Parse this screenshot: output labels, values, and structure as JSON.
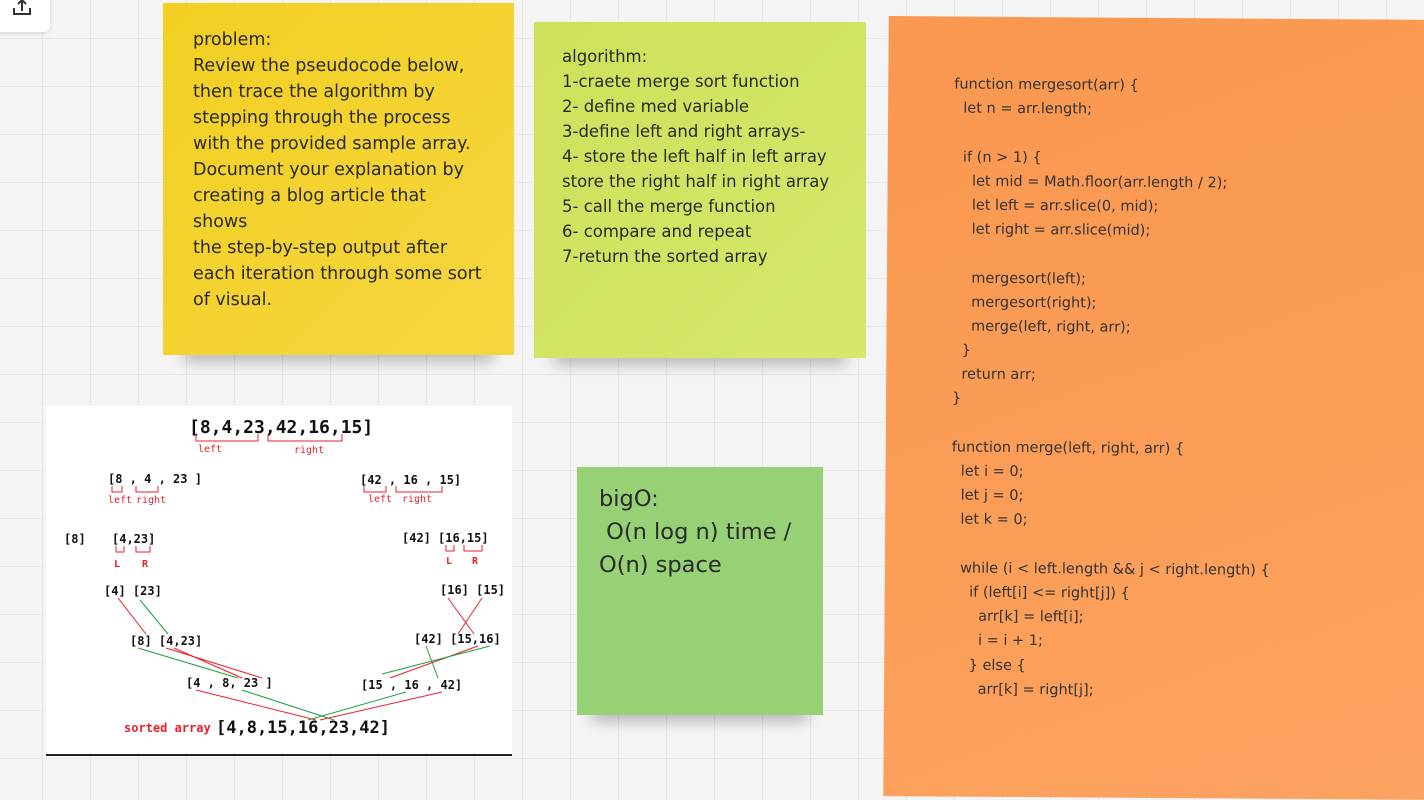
{
  "problem_note": {
    "lines": [
      "problem:",
      "Review the pseudocode below,",
      "then trace the algorithm by",
      "stepping through the process",
      "with the provided sample array.",
      "Document your explanation by",
      "creating a blog article that shows",
      "the step-by-step output after",
      "each iteration through some sort",
      "of visual."
    ]
  },
  "algorithm_note": {
    "lines": [
      "algorithm:",
      "1-craete merge sort function",
      "2- define med variable",
      "3-define left and right arrays-",
      "4- store the left half in left array",
      "store the right half in right array",
      "5- call the merge function",
      "6- compare and repeat",
      "7-return the sorted array"
    ]
  },
  "bigo_note": {
    "lines": [
      "bigO:",
      " O(n log n) time /",
      "O(n) space"
    ]
  },
  "code_note": {
    "lines": [
      "function mergesort(arr) {",
      "  let n = arr.length;",
      "",
      "  if (n > 1) {",
      "    let mid = Math.floor(arr.length / 2);",
      "    let left = arr.slice(0, mid);",
      "    let right = arr.slice(mid);",
      "",
      "    mergesort(left);",
      "    mergesort(right);",
      "    merge(left, right, arr);",
      "  }",
      "  return arr;",
      "}",
      "",
      "function merge(left, right, arr) {",
      "  let i = 0;",
      "  let j = 0;",
      "  let k = 0;",
      "",
      "  while (i < left.length && j < right.length) {",
      "    if (left[i] <= right[j]) {",
      "      arr[k] = left[i];",
      "      i = i + 1;",
      "    } else {",
      "      arr[k] = right[j];"
    ]
  },
  "diagram": {
    "root": "[8,4,23,42,16,15]",
    "root_left": "left",
    "root_right": "right",
    "l1_left": "[8 , 4 , 23 ]",
    "l1_left_l": "left",
    "l1_left_r": "right",
    "l1_right": "[42 , 16 , 15]",
    "l1_right_l": "left",
    "l1_right_r": "right",
    "l2_a": "[8]",
    "l2_b": "[4,23]",
    "l2_b_l": "L",
    "l2_b_r": "R",
    "l2_c": "[42]",
    "l2_d": "[16,15]",
    "l2_d_l": "L",
    "l2_d_r": "R",
    "l3_left": "[4] [23]",
    "l3_right": "[16] [15]",
    "m1_left": "[8] [4,23]",
    "m1_right": "[42] [15,16]",
    "m2_left": "[4 , 8, 23 ]",
    "m2_right": "[15 , 16 , 42]",
    "sorted_label": "sorted array",
    "sorted": "[4,8,15,16,23,42]"
  },
  "colors": {
    "problem": "#f3cf22",
    "algorithm": "#d3e464",
    "bigo": "#97d175",
    "code": "#fa9b55",
    "red": "#e8202a",
    "green": "#1f9e3c"
  },
  "icons": {
    "toolbar": "share-upload-icon"
  }
}
